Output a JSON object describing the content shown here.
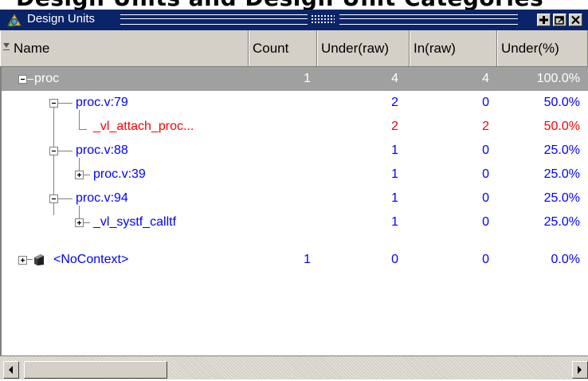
{
  "window": {
    "partial_heading": "Design Units and Design Unit Categories",
    "title": "Design Units",
    "buttons": [
      {
        "name": "dock-button-icon"
      },
      {
        "name": "undock-button-icon"
      },
      {
        "name": "close-icon"
      }
    ]
  },
  "columns": [
    {
      "label": "Name"
    },
    {
      "label": "Count"
    },
    {
      "label": "Under(raw)"
    },
    {
      "label": "In(raw)"
    },
    {
      "label": "Under(%)"
    }
  ],
  "rows": [
    {
      "name": "proc",
      "count": "1",
      "under_raw": "4",
      "in_raw": "4",
      "under_pct": "100.0%",
      "selected": true
    },
    {
      "name": "proc.v:79",
      "count": "",
      "under_raw": "2",
      "in_raw": "0",
      "under_pct": "50.0%"
    },
    {
      "name": "_vl_attach_proc...",
      "count": "",
      "under_raw": "2",
      "in_raw": "2",
      "under_pct": "50.0%",
      "highlight": true
    },
    {
      "name": "proc.v:88",
      "count": "",
      "under_raw": "1",
      "in_raw": "0",
      "under_pct": "25.0%"
    },
    {
      "name": "proc.v:39",
      "count": "",
      "under_raw": "1",
      "in_raw": "0",
      "under_pct": "25.0%"
    },
    {
      "name": "proc.v:94",
      "count": "",
      "under_raw": "1",
      "in_raw": "0",
      "under_pct": "25.0%"
    },
    {
      "name": "_vl_systf_calltf",
      "count": "",
      "under_raw": "1",
      "in_raw": "0",
      "under_pct": "25.0%"
    },
    {
      "name": "<NoContext>",
      "count": "1",
      "under_raw": "0",
      "in_raw": "0",
      "under_pct": "0.0%"
    }
  ],
  "colors": {
    "title_bar": "#0a246a",
    "link_text": "#0000ff",
    "highlight_text": "#ff0000",
    "selected_row": "#a0a0a0"
  }
}
